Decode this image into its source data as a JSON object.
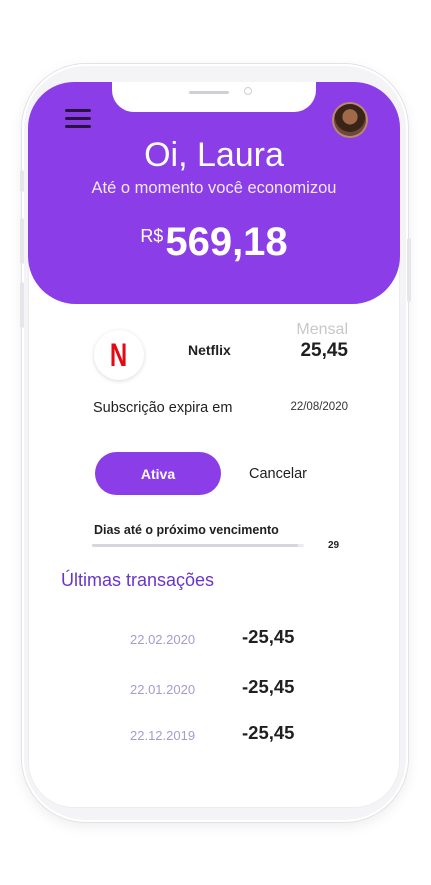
{
  "header": {
    "greeting": "Oi, Laura",
    "subtitle": "Até o momento você economizou",
    "currency": "R$",
    "savings": "569,18"
  },
  "subscription": {
    "logo_letter": "N",
    "service": "Netflix",
    "period": "Mensal",
    "price": "25,45",
    "expires_label": "Subscrição expira em",
    "expires_date": "22/08/2020",
    "active_label": "Ativa",
    "cancel_label": "Cancelar",
    "days_label": "Dias até o próximo vencimento",
    "days_value": "29",
    "days_progress_fraction": 0.97
  },
  "transactions": {
    "title": "Últimas transações",
    "items": [
      {
        "date": "22.02.2020",
        "amount": "-25,45"
      },
      {
        "date": "22.01.2020",
        "amount": "-25,45"
      },
      {
        "date": "22.12.2019",
        "amount": "-25,45"
      }
    ]
  },
  "colors": {
    "accent": "#8b3ee7",
    "title_purple": "#6a35c9",
    "date_lilac": "#a89acb",
    "netflix_red": "#e50914"
  },
  "icons": {
    "menu": "hamburger-menu-icon",
    "avatar": "user-avatar",
    "logo": "netflix-logo"
  }
}
